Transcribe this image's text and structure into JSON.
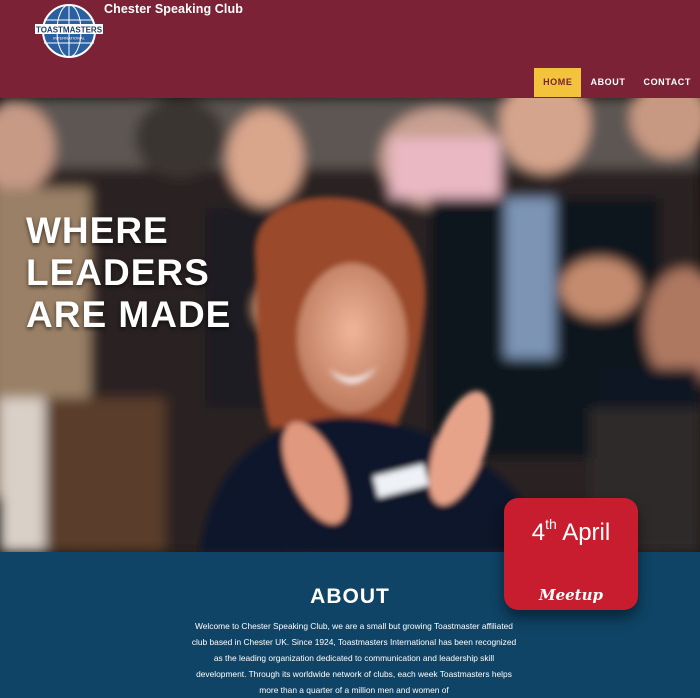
{
  "header": {
    "club_name": "Chester Speaking Club",
    "logo_text": "TOASTMASTERS",
    "logo_subtext": "INTERNATIONAL"
  },
  "nav": {
    "items": [
      {
        "label": "HOME",
        "active": true
      },
      {
        "label": "ABOUT",
        "active": false
      },
      {
        "label": "CONTACT",
        "active": false
      }
    ]
  },
  "hero": {
    "headline": [
      "WHERE",
      "LEADERS",
      "ARE MADE"
    ]
  },
  "badge": {
    "day": "4",
    "suffix": "th",
    "month": "April",
    "label": "Meetup"
  },
  "about": {
    "title": "ABOUT",
    "body": "Welcome to Chester Speaking Club, we are a small but growing Toastmaster affiliated club based in Chester UK. Since 1924, Toastmasters International has been recognized as the leading organization dedicated to communication and leadership skill development. Through its worldwide network of clubs, each week Toastmasters helps more than a quarter of a million men and women of"
  },
  "colors": {
    "header_bg": "#7b2237",
    "nav_active": "#f2c33b",
    "badge": "#c81d2e",
    "about_bg": "#0f4466"
  }
}
